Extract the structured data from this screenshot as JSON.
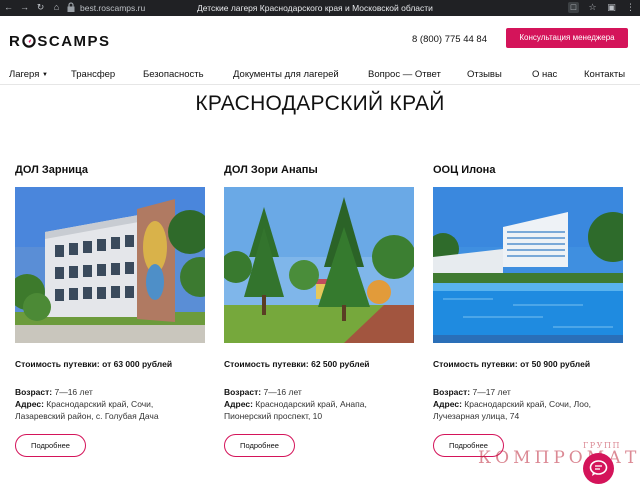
{
  "browser": {
    "url": "best.roscamps.ru",
    "tab_title": "Детские лагеря Краснодарского края и Московской области"
  },
  "header": {
    "logo": [
      "R",
      "S",
      "CAMPS"
    ],
    "phone": "8 (800) 775 44 84",
    "cta_label": "Консультация менеджера"
  },
  "menu": [
    {
      "label": "Лагеря",
      "dropdown": true
    },
    {
      "label": "Трансфер"
    },
    {
      "label": "Безопасность"
    },
    {
      "label": "Документы для лагерей"
    },
    {
      "label": "Вопрос — Ответ"
    },
    {
      "label": "Отзывы"
    },
    {
      "label": "О нас"
    },
    {
      "label": "Контакты"
    }
  ],
  "page_title": "КРАСНОДАРСКИЙ КРАЙ",
  "cards": [
    {
      "title": "ДОЛ Зарница",
      "price": "Стоимость путевки: от 63 000 рублей",
      "age_label": "Возраст:",
      "age": "7—16 лет",
      "address_label": "Адрес:",
      "address": "Краснодарский край, Сочи, Лазаревский район, с. Голубая Дача",
      "button": "Подробнее"
    },
    {
      "title": "ДОЛ Зори Анапы",
      "price": "Стоимость путевки: 62 500 рублей",
      "age_label": "Возраст:",
      "age": "7—16 лет",
      "address_label": "Адрес:",
      "address": "Краснодарский край, Анапа, Пионерский проспект, 10",
      "button": "Подробнее"
    },
    {
      "title": "ООЦ Илона",
      "price": "Стоимость путевки: от 50 900 рублей",
      "age_label": "Возраст:",
      "age": "7—17 лет",
      "address_label": "Адрес:",
      "address": "Краснодарский край, Сочи, Лоо, Лучезарная улица, 74",
      "button": "Подробнее"
    }
  ],
  "watermark": {
    "top": "ГРУПП",
    "main": "КОМПРОМАТ"
  },
  "colors": {
    "accent": "#d4145a",
    "chrome": "#202124"
  }
}
